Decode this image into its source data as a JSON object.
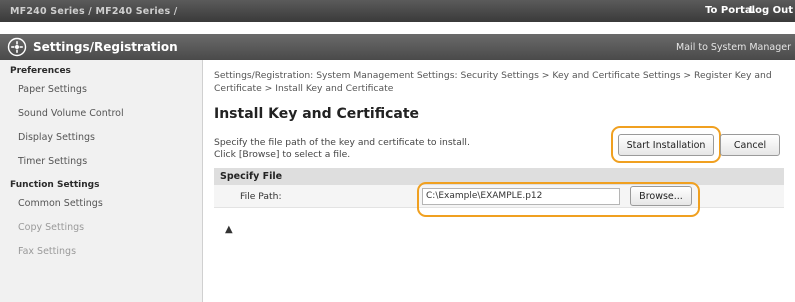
{
  "topbar": {
    "device": "MF240 Series / MF240 Series /",
    "portal": "To Portal",
    "logout": "Log Out"
  },
  "header": {
    "icon": "gear-settings-icon",
    "title": "Settings/Registration",
    "mail": "Mail to System Manager"
  },
  "sidebar": {
    "groups": [
      {
        "label": "Preferences",
        "items": [
          "Paper Settings",
          "Sound Volume Control",
          "Display Settings",
          "Timer Settings"
        ]
      },
      {
        "label": "Function Settings",
        "items": [
          "Common Settings",
          "Copy Settings",
          "Fax Settings"
        ]
      }
    ]
  },
  "main": {
    "breadcrumb": "Settings/Registration: System Management Settings: Security Settings > Key and Certificate Settings > Register Key and Certificate > Install Key and Certificate",
    "title": "Install Key and Certificate",
    "description_line1": "Specify the file path of the key and certificate to install.",
    "description_line2": "Click [Browse] to select a file.",
    "start_button": "Start Installation",
    "cancel_button": "Cancel",
    "section_title": "Specify File",
    "file_path_label": "File Path:",
    "file_path_value": "C:\\Example\\EXAMPLE.p12",
    "browse_button": "Browse...",
    "top_link": "▲"
  },
  "colors": {
    "highlight": "#f0a020",
    "header_bg": "#555555"
  }
}
